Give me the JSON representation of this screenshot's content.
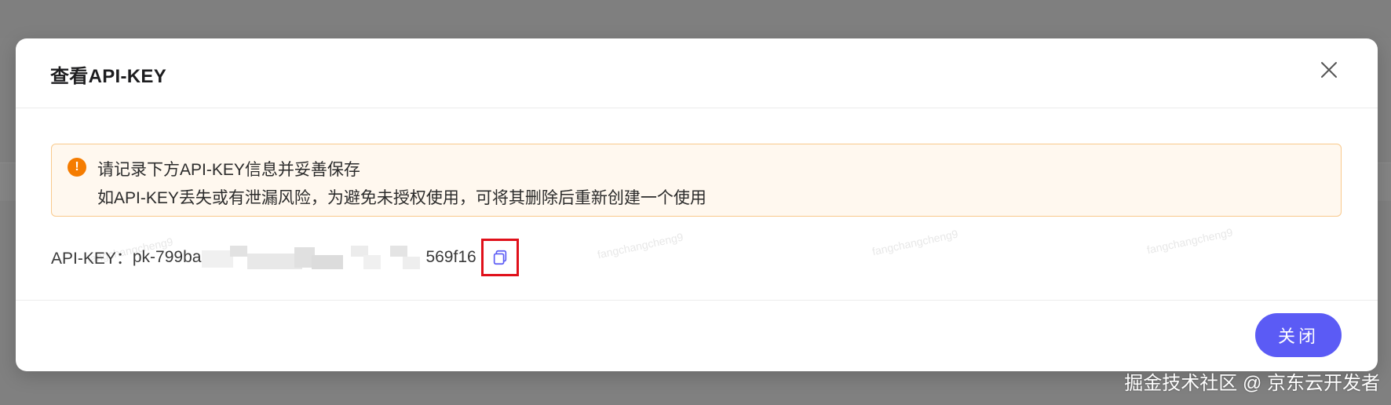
{
  "modal": {
    "title": "查看API-KEY",
    "close_icon": "close-icon",
    "alert": {
      "icon": "warning-icon",
      "line1": "请记录下方API-KEY信息并妥善保存",
      "line2": "如API-KEY丢失或有泄漏风险，为避免未授权使用，可将其删除后重新创建一个使用"
    },
    "api_key": {
      "label": "API-KEY：",
      "prefix": "pk-799ba",
      "suffix": "569f16",
      "copy_icon": "copy-icon"
    },
    "close_button_label": "关闭"
  },
  "watermark_text": "fangchangcheng9",
  "credit": "掘金技术社区 @ 京东云开发者",
  "colors": {
    "primary_button": "#5b5bf5",
    "alert_bg": "#fff8ef",
    "alert_border": "#f9c98c",
    "warning_icon": "#f57c00",
    "highlight_box": "#e0101a",
    "overlay": "#808080"
  }
}
